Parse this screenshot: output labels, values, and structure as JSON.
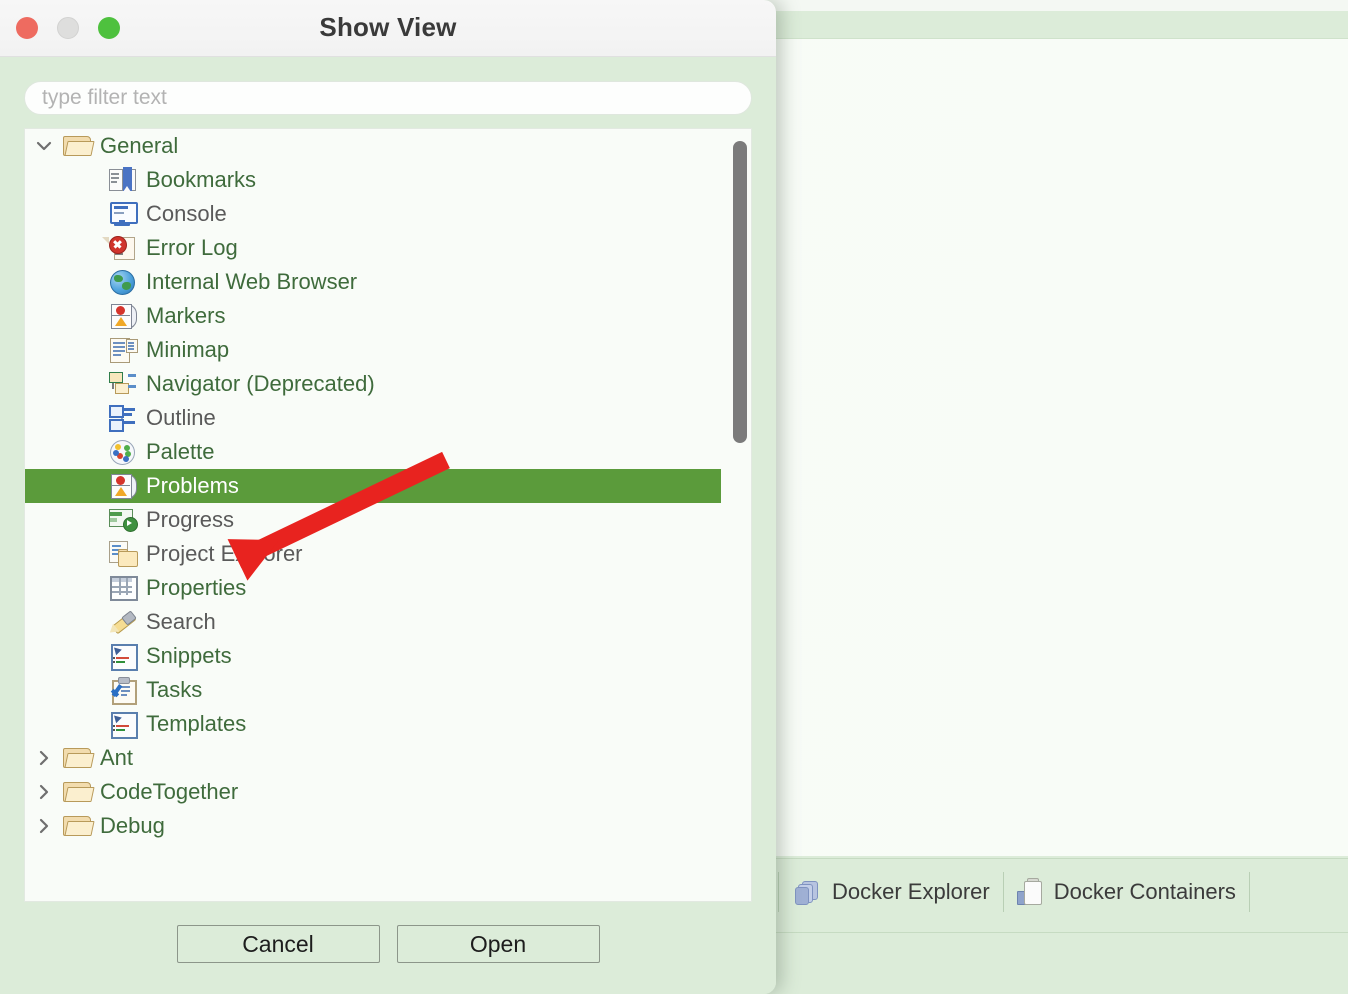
{
  "background": {
    "tabs": [
      {
        "label": "Docker Explorer",
        "icon": "docker-explorer-icon"
      },
      {
        "label": "Docker Containers",
        "icon": "docker-containers-icon"
      }
    ]
  },
  "dialog": {
    "title": "Show View",
    "window_controls": {
      "close": "close-button",
      "minimize": "minimize-button",
      "maximize": "maximize-button"
    },
    "filter": {
      "value": "",
      "placeholder": "type filter text"
    },
    "tree": {
      "selected_item": "Problems",
      "selection_color": "#5b9b3b",
      "items": [
        {
          "label": "General",
          "icon": "folder-open-icon",
          "level": 0,
          "twisty": "expanded",
          "color": "green"
        },
        {
          "label": "Bookmarks",
          "icon": "bookmarks-icon",
          "level": 1,
          "twisty": "none",
          "color": "green"
        },
        {
          "label": "Console",
          "icon": "console-icon",
          "level": 1,
          "twisty": "none",
          "color": "gray"
        },
        {
          "label": "Error Log",
          "icon": "error-log-icon",
          "level": 1,
          "twisty": "none",
          "color": "green"
        },
        {
          "label": "Internal Web Browser",
          "icon": "globe-icon",
          "level": 1,
          "twisty": "none",
          "color": "green"
        },
        {
          "label": "Markers",
          "icon": "markers-icon",
          "level": 1,
          "twisty": "none",
          "color": "green"
        },
        {
          "label": "Minimap",
          "icon": "minimap-icon",
          "level": 1,
          "twisty": "none",
          "color": "green"
        },
        {
          "label": "Navigator (Deprecated)",
          "icon": "navigator-icon",
          "level": 1,
          "twisty": "none",
          "color": "green"
        },
        {
          "label": "Outline",
          "icon": "outline-icon",
          "level": 1,
          "twisty": "none",
          "color": "gray"
        },
        {
          "label": "Palette",
          "icon": "palette-icon",
          "level": 1,
          "twisty": "none",
          "color": "green"
        },
        {
          "label": "Problems",
          "icon": "problems-icon",
          "level": 1,
          "twisty": "none",
          "color": "selected"
        },
        {
          "label": "Progress",
          "icon": "progress-icon",
          "level": 1,
          "twisty": "none",
          "color": "gray"
        },
        {
          "label": "Project Explorer",
          "icon": "project-explorer-icon",
          "level": 1,
          "twisty": "none",
          "color": "gray"
        },
        {
          "label": "Properties",
          "icon": "properties-icon",
          "level": 1,
          "twisty": "none",
          "color": "green"
        },
        {
          "label": "Search",
          "icon": "search-icon",
          "level": 1,
          "twisty": "none",
          "color": "gray"
        },
        {
          "label": "Snippets",
          "icon": "snippets-icon",
          "level": 1,
          "twisty": "none",
          "color": "green"
        },
        {
          "label": "Tasks",
          "icon": "tasks-icon",
          "level": 1,
          "twisty": "none",
          "color": "green"
        },
        {
          "label": "Templates",
          "icon": "templates-icon",
          "level": 1,
          "twisty": "none",
          "color": "green"
        },
        {
          "label": "Ant",
          "icon": "folder-open-icon",
          "level": 0,
          "twisty": "collapsed",
          "color": "green"
        },
        {
          "label": "CodeTogether",
          "icon": "folder-open-icon",
          "level": 0,
          "twisty": "collapsed",
          "color": "green"
        },
        {
          "label": "Debug",
          "icon": "folder-open-icon",
          "level": 0,
          "twisty": "collapsed",
          "color": "green"
        }
      ]
    },
    "buttons": {
      "cancel": "Cancel",
      "open": "Open"
    },
    "annotation": {
      "type": "arrow",
      "color": "#e8231f",
      "points_to": "Problems"
    }
  }
}
